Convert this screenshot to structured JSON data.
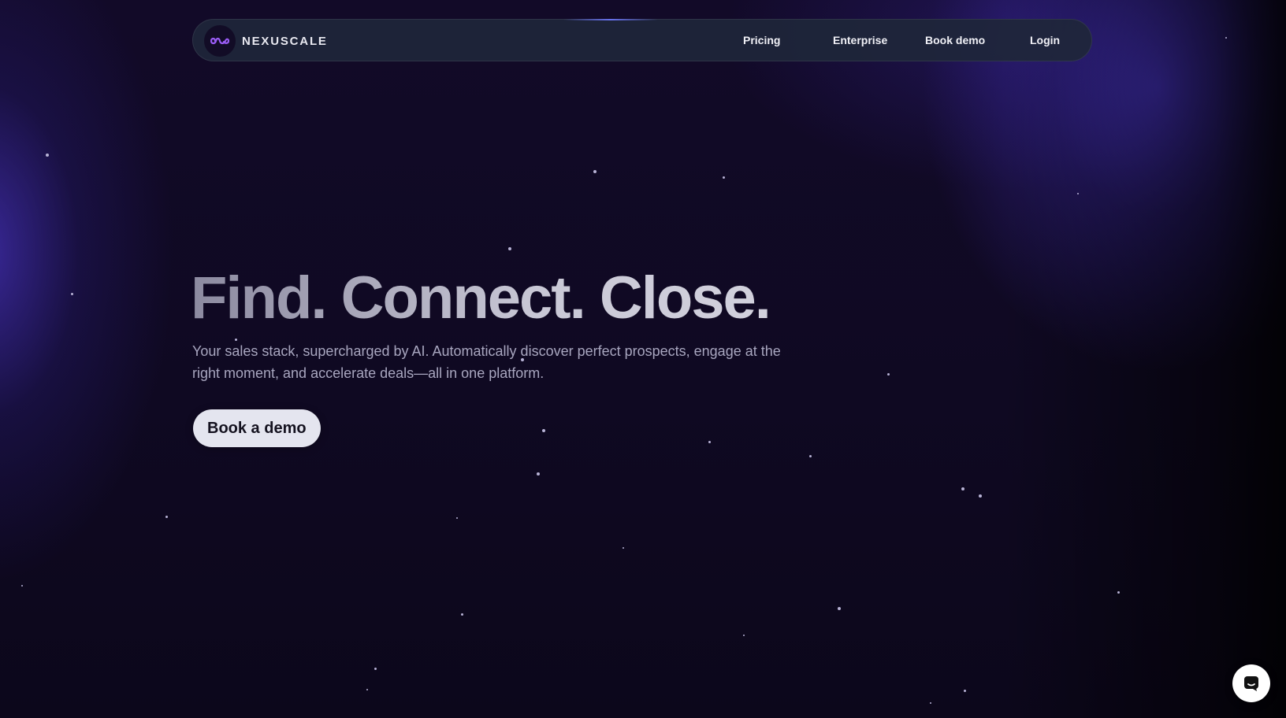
{
  "brand": {
    "name": "NEXUSCALE",
    "logo_icon": "infinity-loop-icon",
    "accent": "#8b5cf6"
  },
  "nav": {
    "links": [
      "Pricing",
      "Enterprise",
      "Book demo",
      "Login"
    ]
  },
  "hero": {
    "headline": "Find. Connect. Close.",
    "subtext": "Your sales stack, supercharged by AI. Automatically discover perfect prospects, engage at the right moment, and accelerate deals—all in one platform.",
    "cta_label": "Book a demo"
  },
  "chat_widget": {
    "icon": "chat-bubble-icon"
  },
  "colors": {
    "background": "#0e0820",
    "glow": "#4834c8",
    "navbar": "#1e263a",
    "cta_bg": "#e4e5ef",
    "cta_text": "#14121f"
  }
}
